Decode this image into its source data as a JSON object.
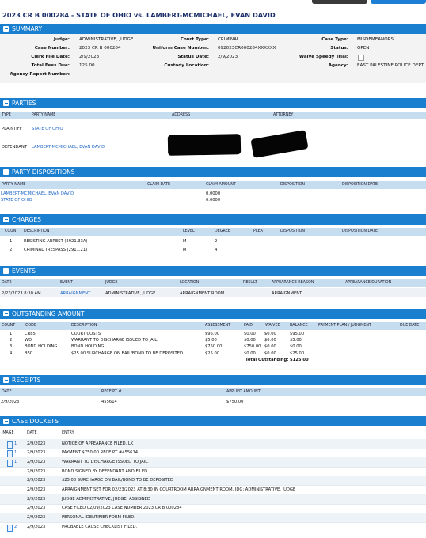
{
  "case_title": "2023 CR B 000284 - STATE OF OHIO vs. LAMBERT-MCMICHAEL, EVAN DAVID",
  "sections": {
    "summary": "SUMMARY",
    "parties": "PARTIES",
    "party_dispositions": "PARTY DISPOSITIONS",
    "charges": "CHARGES",
    "events": "EVENTS",
    "outstanding": "OUTSTANDING AMOUNT",
    "receipts": "RECEIPTS",
    "dockets": "CASE DOCKETS"
  },
  "summary": {
    "judge_k": "Judge:",
    "judge_v": "ADMINISTRATIVE, JUDGE",
    "case_number_k": "Case Number:",
    "case_number_v": "2023 CR B 000284",
    "clerk_file_date_k": "Clerk File Date:",
    "clerk_file_date_v": "2/9/2023",
    "total_fees_k": "Total Fees Due:",
    "total_fees_v": "125.00",
    "agency_report_k": "Agency Report Number:",
    "agency_report_v": "",
    "court_type_k": "Court Type:",
    "court_type_v": "CRIMINAL",
    "uniform_case_k": "Uniform Case Number:",
    "uniform_case_v": "092023CR000284XXXXXX",
    "status_date_k": "Status Date:",
    "status_date_v": "2/9/2023",
    "custody_k": "Custody Location:",
    "custody_v": "",
    "case_type_k": "Case Type:",
    "case_type_v": "MISDEMEANORS",
    "status_k": "Status:",
    "status_v": "OPEN",
    "waive_k": "Waive Speedy Trial:",
    "waive_v": "",
    "agency_k": "Agency:",
    "agency_v": "EAST PALESTINE POLICE DEPT"
  },
  "parties": {
    "headers": [
      "TYPE",
      "PARTY NAME",
      "ADDRESS",
      "ATTORNEY"
    ],
    "rows": [
      {
        "type": "PLAINTIFF",
        "name": "STATE OF OHIO"
      },
      {
        "type": "DEFENDANT",
        "name": "LAMBERT-MCMICHAEL, EVAN DAVID"
      }
    ]
  },
  "party_dispositions": {
    "headers": [
      "PARTY NAME",
      "CLAIM DATE",
      "CLAIM AMOUNT",
      "DISPOSITION",
      "DISPOSITION DATE"
    ],
    "rows": [
      {
        "name": "LAMBERT-MCMICHAEL, EVAN DAVID",
        "amount": "0.0000"
      },
      {
        "name": "STATE OF OHIO",
        "amount": "0.0000"
      }
    ]
  },
  "charges": {
    "headers": [
      "COUNT",
      "DESCRIPTION",
      "LEVEL",
      "DEGREE",
      "PLEA",
      "DISPOSITION",
      "DISPOSITION DATE"
    ],
    "rows": [
      {
        "count": "1",
        "desc": "RESISTING ARREST (2921.33A)",
        "level": "M",
        "degree": "2"
      },
      {
        "count": "2",
        "desc": "CRIMINAL TRESPASS (2911.21)",
        "level": "M",
        "degree": "4"
      }
    ]
  },
  "events": {
    "headers": [
      "DATE",
      "EVENT",
      "JUDGE",
      "LOCATION",
      "RESULT",
      "APPEARANCE REASON",
      "APPEARANCE DURATION"
    ],
    "rows": [
      {
        "date": "2/23/2023 8:30 AM",
        "event": "ARRAIGNMENT",
        "judge": "ADMINISTRATIVE, JUDGE",
        "location": "ARRAIGNMENT ROOM",
        "reason": "ARRAIGNMENT"
      }
    ]
  },
  "outstanding": {
    "headers": [
      "COUNT",
      "CODE",
      "DESCRIPTION",
      "ASSESSMENT",
      "PAID",
      "WAIVED",
      "BALANCE",
      "PAYMENT PLAN / JUDGMENT",
      "DUE DATE"
    ],
    "rows": [
      {
        "count": "1",
        "code": "CR85",
        "desc": "COURT COSTS",
        "assess": "$95.00",
        "paid": "$0.00",
        "waived": "$0.00",
        "balance": "$95.00"
      },
      {
        "count": "2",
        "code": "WD",
        "desc": "WARRANT TO DISCHARGE ISSUED TO JAIL.",
        "assess": "$5.00",
        "paid": "$0.00",
        "waived": "$0.00",
        "balance": "$5.00"
      },
      {
        "count": "3",
        "code": "BOND HOLDING",
        "desc": "BOND HOLDING",
        "assess": "$750.00",
        "paid": "$750.00",
        "waived": "$0.00",
        "balance": "$0.00"
      },
      {
        "count": "4",
        "code": "BSC",
        "desc": "$25.00 SURCHARGE ON BAIL/BOND TO BE DEPOSITED",
        "assess": "$25.00",
        "paid": "$0.00",
        "waived": "$0.00",
        "balance": "$25.00"
      }
    ],
    "total_label": "Total Outstanding:",
    "total_value": "$125.00"
  },
  "receipts": {
    "headers": [
      "DATE",
      "RECEIPT #",
      "APPLIED AMOUNT"
    ],
    "rows": [
      {
        "date": "2/9/2023",
        "receipt": "455614",
        "amount": "$750.00"
      }
    ]
  },
  "dockets": {
    "headers": [
      "IMAGE",
      "DATE",
      "ENTRY"
    ],
    "rows": [
      {
        "img": "1",
        "date": "2/9/2023",
        "entry": "NOTICE OF APPEARANCE FILED. LK"
      },
      {
        "img": "1",
        "date": "2/9/2023",
        "entry": "PAYMENT $750.00 RECEIPT #455614"
      },
      {
        "img": "1",
        "date": "2/9/2023",
        "entry": "WARRANT TO DISCHARGE ISSUED TO JAIL."
      },
      {
        "img": "",
        "date": "2/9/2023",
        "entry": "BOND SIGNED BY DEFENDANT AND FILED."
      },
      {
        "img": "",
        "date": "2/9/2023",
        "entry": "$25.00 SURCHARGE ON BAIL/BOND TO BE DEPOSITED"
      },
      {
        "img": "",
        "date": "2/9/2023",
        "entry": "ARRAIGNMENT SET FOR 02/23/2023 AT 8:30 IN COURTROOM ARRAIGNMENT ROOM, JDG: ADMINISTRATIVE, JUDGE"
      },
      {
        "img": "",
        "date": "2/9/2023",
        "entry": "JUDGE ADMINISTRATIVE, JUDGE: ASSIGNED"
      },
      {
        "img": "",
        "date": "2/9/2023",
        "entry": "CASE FILED 02/09/2023 CASE NUMBER 2023 CR B 000284"
      },
      {
        "img": "",
        "date": "2/9/2023",
        "entry": "PERSONAL IDENTIFIER FORM FILED."
      },
      {
        "img": "2",
        "date": "2/9/2023",
        "entry": "PROBABLE CAUSE CHECKLIST FILED."
      }
    ]
  }
}
